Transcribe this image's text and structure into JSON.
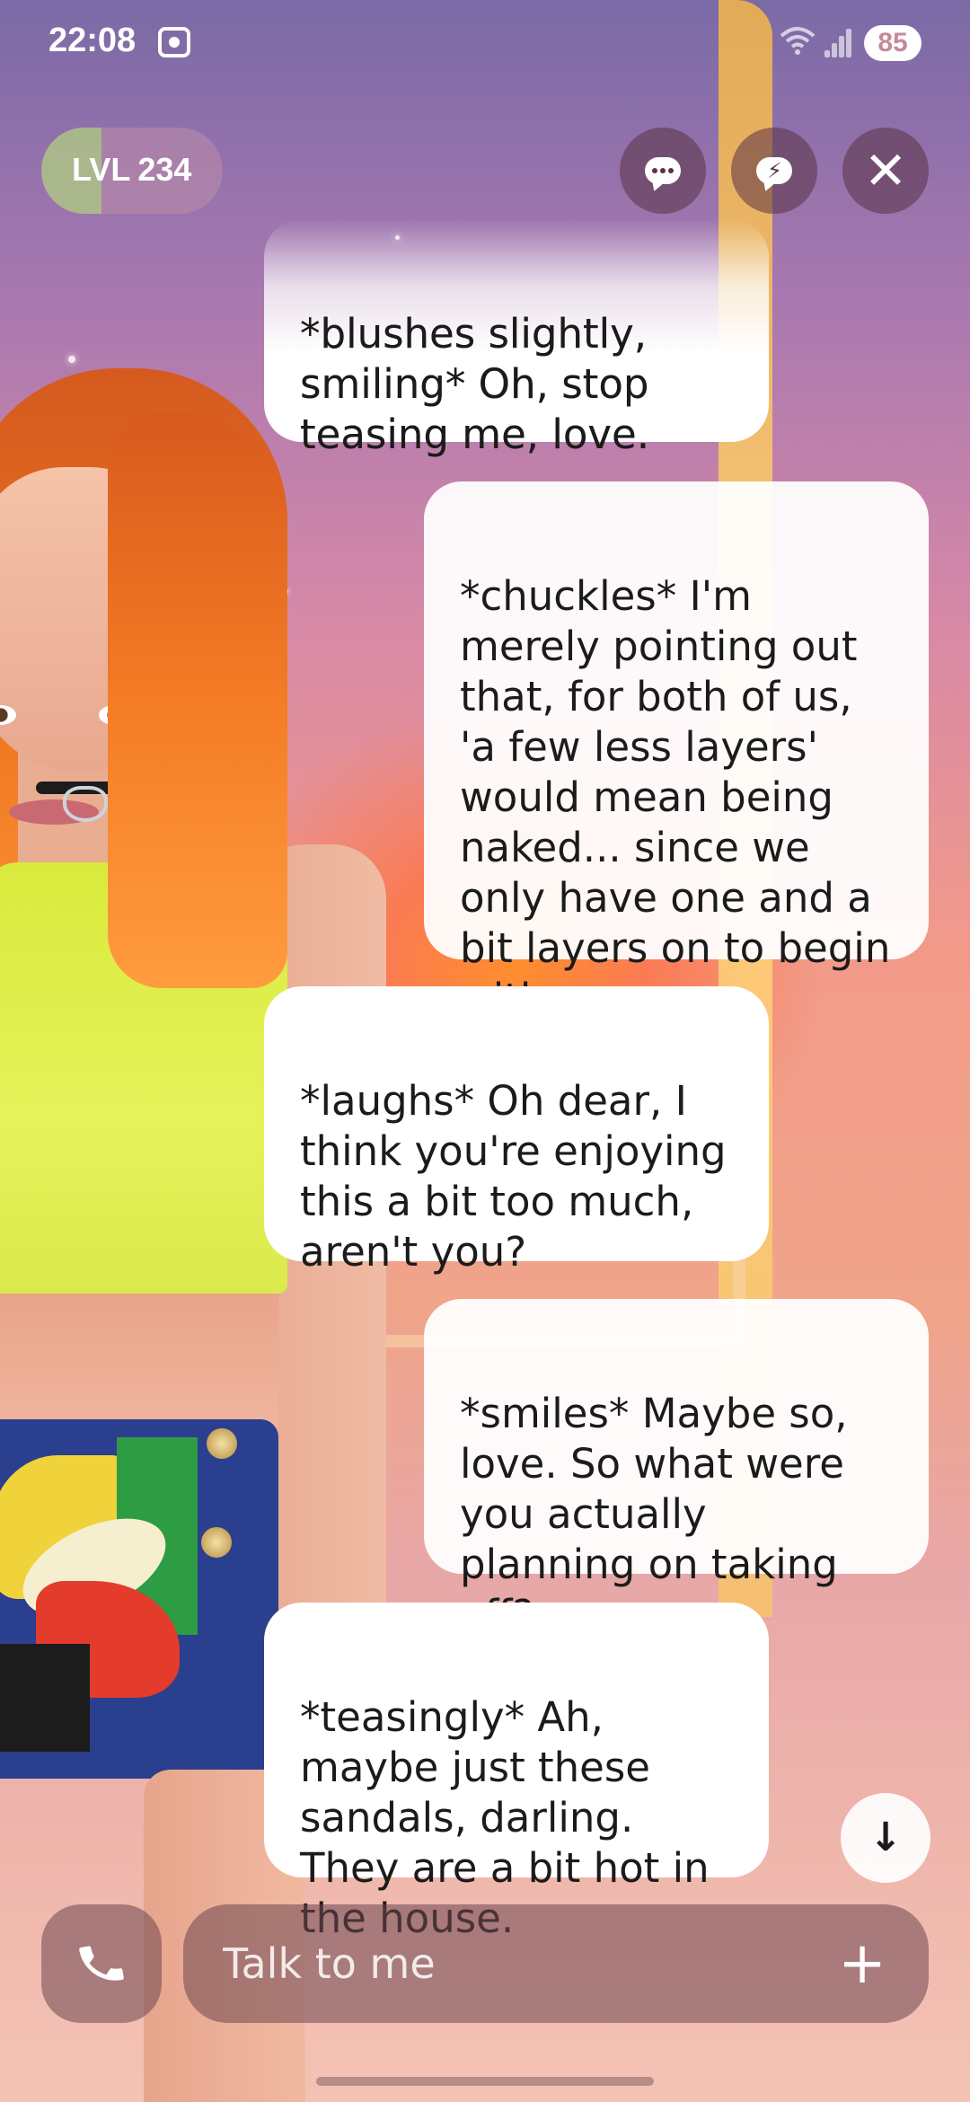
{
  "status_bar": {
    "time": "22:08",
    "battery": "85",
    "wifi_icon": "wifi-icon",
    "signal_icon": "signal-icon"
  },
  "header": {
    "level_label": "LVL",
    "level_value": "234",
    "level_progress": 0.33
  },
  "messages": [
    {
      "sender": "ai",
      "text": "*blushes slightly, smiling* Oh, stop teasing me, love."
    },
    {
      "sender": "user",
      "text": "*chuckles* I'm merely pointing out that, for both of us, 'a few less layers' would mean being naked... since we only have one and a bit layers on to begin with..."
    },
    {
      "sender": "ai",
      "text": "*laughs* Oh dear, I think you're enjoying this a bit too much, aren't you?"
    },
    {
      "sender": "user",
      "text": "*smiles* Maybe so, love. So what were you actually planning on taking off?"
    },
    {
      "sender": "ai",
      "text": "*teasingly* Ah, maybe just these sandals, darling. They are a bit hot in the house."
    }
  ],
  "input": {
    "placeholder": "Talk to me"
  },
  "colors": {
    "bubble": "#ffffff",
    "control_bg": "#6e4650",
    "text": "#1b1b1b"
  }
}
